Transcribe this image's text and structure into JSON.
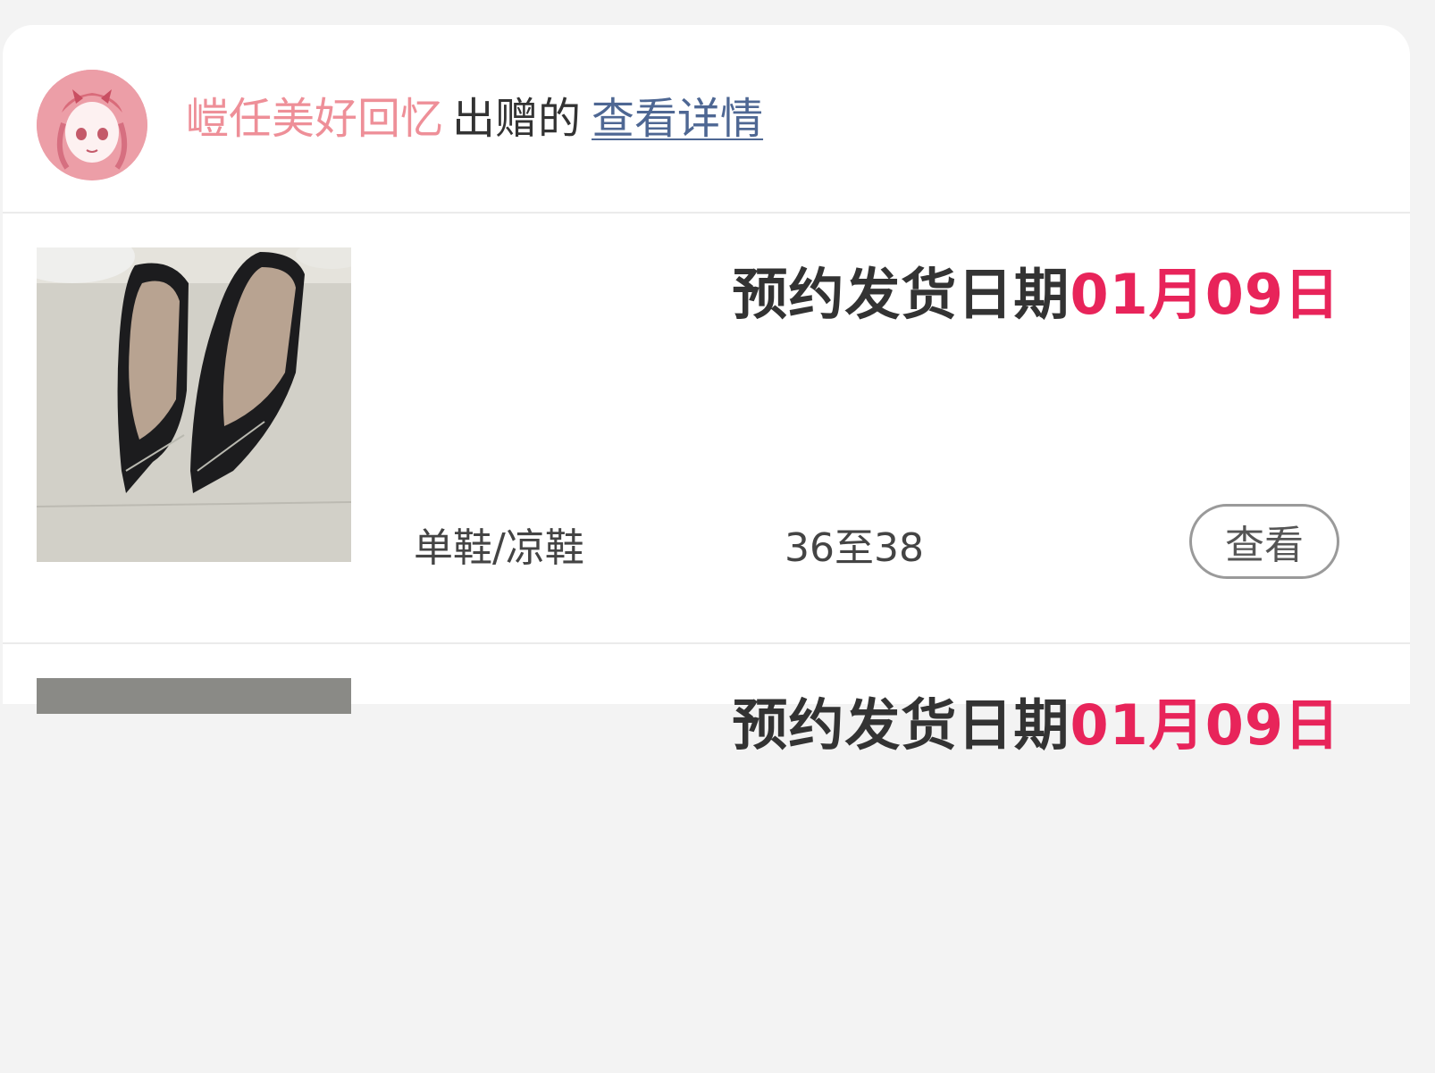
{
  "header": {
    "giver_name": "嵦任美好回忆",
    "gift_text": "出赠的",
    "detail_link": "查看详情"
  },
  "items": [
    {
      "ship_label": "预约发货日期",
      "ship_date": "01月09日",
      "category": "单鞋/凉鞋",
      "size": "36至38",
      "view_button": "查看",
      "image": "black-pointed-heels"
    },
    {
      "ship_label": "预约发货日期",
      "ship_date": "01月09日"
    }
  ],
  "colors": {
    "accent_red": "#e8245a",
    "giver_pink": "#ee8f98",
    "link_blue": "#4e6793"
  }
}
